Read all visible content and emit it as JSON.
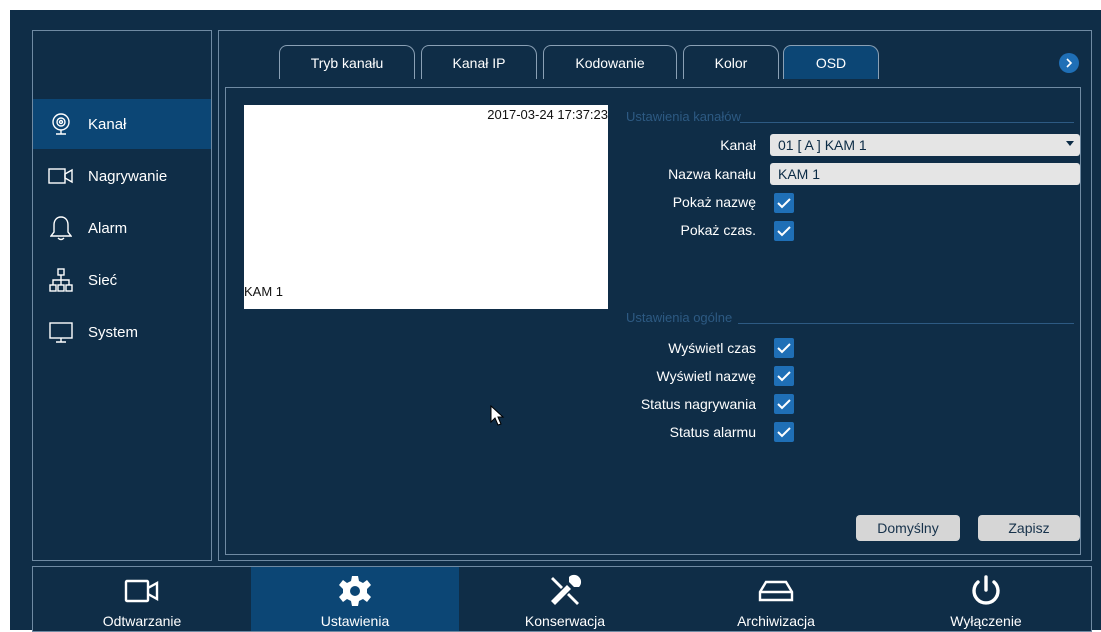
{
  "sidebar": {
    "items": [
      {
        "label": "Kanał",
        "icon": "camera-lens-icon",
        "active": true
      },
      {
        "label": "Nagrywanie",
        "icon": "video-camera-icon",
        "active": false
      },
      {
        "label": "Alarm",
        "icon": "bell-icon",
        "active": false
      },
      {
        "label": "Sieć",
        "icon": "network-icon",
        "active": false
      },
      {
        "label": "System",
        "icon": "monitor-icon",
        "active": false
      }
    ]
  },
  "tabs": [
    {
      "label": "Tryb kanału",
      "active": false
    },
    {
      "label": "Kanał IP",
      "active": false
    },
    {
      "label": "Kodowanie",
      "active": false
    },
    {
      "label": "Kolor",
      "active": false
    },
    {
      "label": "OSD",
      "active": true
    }
  ],
  "preview": {
    "timestamp": "2017-03-24 17:37:23",
    "camera_name": "KAM 1"
  },
  "channel_settings": {
    "title": "Ustawienia kanałów",
    "channel_label": "Kanał",
    "channel_value": "01 [ A ] KAM 1",
    "name_label": "Nazwa kanału",
    "name_value": "KAM 1",
    "show_name_label": "Pokaż nazwę",
    "show_name_checked": true,
    "show_time_label": "Pokaż czas.",
    "show_time_checked": true
  },
  "general_settings": {
    "title": "Ustawienia ogólne",
    "items": [
      {
        "label": "Wyświetl czas",
        "checked": true
      },
      {
        "label": "Wyświetl nazwę",
        "checked": true
      },
      {
        "label": "Status nagrywania",
        "checked": true
      },
      {
        "label": "Status alarmu",
        "checked": true
      }
    ]
  },
  "buttons": {
    "default_label": "Domyślny",
    "save_label": "Zapisz"
  },
  "footer_nav": [
    {
      "label": "Odtwarzanie",
      "icon": "video-camera-icon",
      "active": false
    },
    {
      "label": "Ustawienia",
      "icon": "gear-icon",
      "active": true
    },
    {
      "label": "Konserwacja",
      "icon": "tools-icon",
      "active": false
    },
    {
      "label": "Archiwizacja",
      "icon": "archive-icon",
      "active": false
    },
    {
      "label": "Wyłączenie",
      "icon": "power-icon",
      "active": false
    }
  ],
  "colors": {
    "background": "#0f2d47",
    "active": "#0c4675",
    "accent": "#1f6fb6",
    "border": "#6f8aa3"
  }
}
